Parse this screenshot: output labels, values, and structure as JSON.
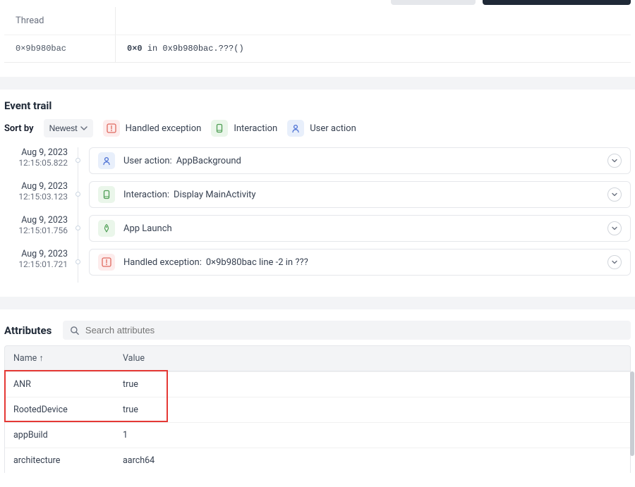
{
  "thread": {
    "header": "Thread",
    "address": "0×9b980bac",
    "value_head": "0×0",
    "value_mid": " in ",
    "value_tail": "0x9b980bac.???()"
  },
  "event_trail": {
    "title": "Event trail",
    "sort_label": "Sort by",
    "sort_value": "Newest",
    "legend": {
      "handled": "Handled exception",
      "interaction": "Interaction",
      "user": "User action"
    },
    "events": [
      {
        "date": "Aug 9, 2023",
        "time": "12:15:05.822",
        "icon": "user",
        "label": "User action:",
        "value": "AppBackground"
      },
      {
        "date": "Aug 9, 2023",
        "time": "12:15:03.123",
        "icon": "interaction",
        "label": "Interaction:",
        "value": "Display MainActivity"
      },
      {
        "date": "Aug 9, 2023",
        "time": "12:15:01.756",
        "icon": "launch",
        "label": "App Launch",
        "value": ""
      },
      {
        "date": "Aug 9, 2023",
        "time": "12:15:01.721",
        "icon": "handled",
        "label": "Handled exception:",
        "value": "0×9b980bac line -2 in ???"
      }
    ]
  },
  "attributes": {
    "title": "Attributes",
    "search_placeholder": "Search attributes",
    "columns": {
      "name": "Name ↑",
      "value": "Value"
    },
    "rows": [
      {
        "name": "ANR",
        "value": "true"
      },
      {
        "name": "RootedDevice",
        "value": "true"
      },
      {
        "name": "appBuild",
        "value": "1"
      },
      {
        "name": "architecture",
        "value": "aarch64"
      }
    ]
  }
}
